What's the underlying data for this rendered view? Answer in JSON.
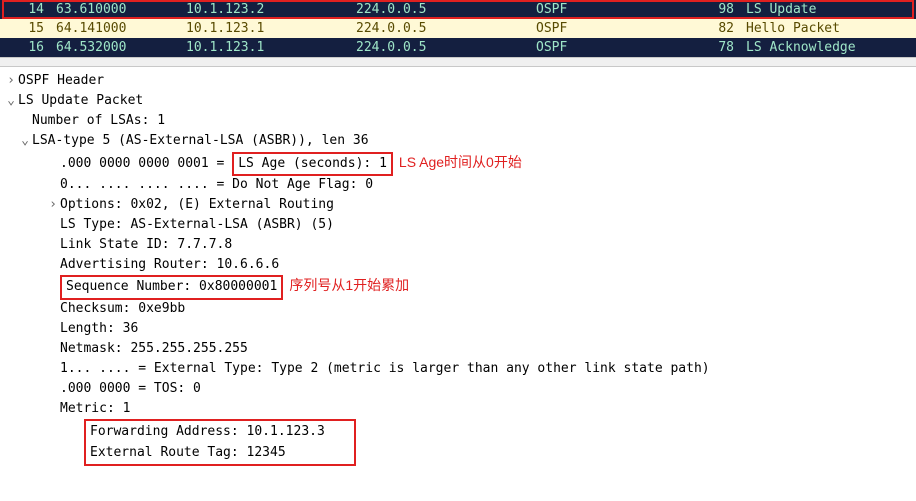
{
  "packets": [
    {
      "no": "14",
      "time": "63.610000",
      "src": "10.1.123.2",
      "dst": "224.0.0.5",
      "proto": "OSPF",
      "len": "98",
      "info": "LS Update",
      "style": "dark",
      "highlight": true
    },
    {
      "no": "15",
      "time": "64.141000",
      "src": "10.1.123.1",
      "dst": "224.0.0.5",
      "proto": "OSPF",
      "len": "82",
      "info": "Hello Packet",
      "style": "light",
      "highlight": false
    },
    {
      "no": "16",
      "time": "64.532000",
      "src": "10.1.123.1",
      "dst": "224.0.0.5",
      "proto": "OSPF",
      "len": "78",
      "info": "LS Acknowledge",
      "style": "dark",
      "highlight": false
    }
  ],
  "tree": {
    "ospf_header": "OSPF Header",
    "ls_update_packet": "LS Update Packet",
    "num_lsas": "Number of LSAs: 1",
    "lsa_type5": "LSA-type 5 (AS-External-LSA (ASBR)), len 36",
    "ls_age_bits": ".000 0000 0000 0001 = ",
    "ls_age_label": "LS Age (seconds): 1",
    "ls_age_annot": "LS Age时间从0开始",
    "do_not_age": "0... .... .... .... = Do Not Age Flag: 0",
    "options": "Options: 0x02, (E) External Routing",
    "ls_type": "LS Type: AS-External-LSA (ASBR) (5)",
    "link_state_id": "Link State ID: 7.7.7.8",
    "adv_router": "Advertising Router: 10.6.6.6",
    "seq_num": "Sequence Number: 0x80000001",
    "seq_annot": "序列号从1开始累加",
    "checksum": "Checksum: 0xe9bb",
    "length": "Length: 36",
    "netmask": "Netmask: 255.255.255.255",
    "ext_type": "1... .... = External Type: Type 2 (metric is larger than any other link state path)",
    "tos": ".000 0000 = TOS: 0",
    "metric": "Metric: 1",
    "fwd_addr": "Forwarding Address: 10.1.123.3",
    "ext_tag": "External Route Tag: 12345"
  }
}
